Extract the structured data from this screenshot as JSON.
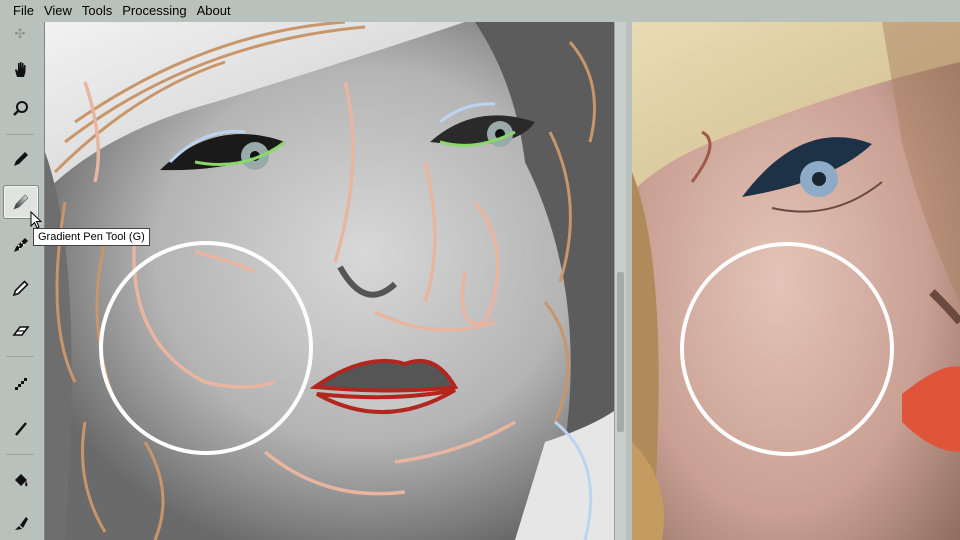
{
  "menu": {
    "items": [
      "File",
      "View",
      "Tools",
      "Processing",
      "About"
    ]
  },
  "toolbar": {
    "tools": [
      {
        "name": "hand-tool",
        "icon": "hand-icon"
      },
      {
        "name": "zoom-tool",
        "icon": "magnifier-icon"
      },
      {
        "name": "pen-tool",
        "icon": "pen-icon"
      },
      {
        "name": "gradient-pen-tool",
        "icon": "gradient-pen-icon",
        "active": true
      },
      {
        "name": "dotted-pen-tool",
        "icon": "dotted-pen-icon"
      },
      {
        "name": "pencil-tool",
        "icon": "pencil-icon"
      },
      {
        "name": "eraser-tool",
        "icon": "eraser-icon"
      },
      {
        "name": "gradient-line-tool",
        "icon": "gradient-line-icon"
      },
      {
        "name": "line-tool",
        "icon": "line-icon"
      },
      {
        "name": "bucket-tool",
        "icon": "paint-bucket-icon"
      },
      {
        "name": "brush-tool",
        "icon": "brush-icon"
      }
    ],
    "tooltip": "Gradient Pen Tool (G)"
  },
  "colors": {
    "chrome": "#b9c1bd",
    "highlight_circle": "#ffffff",
    "lip_outline": "#b3261e",
    "skin_stroke": "#e8b5a0",
    "hair_stroke": "#c8966a",
    "eye_stroke": "#8ad86a"
  }
}
